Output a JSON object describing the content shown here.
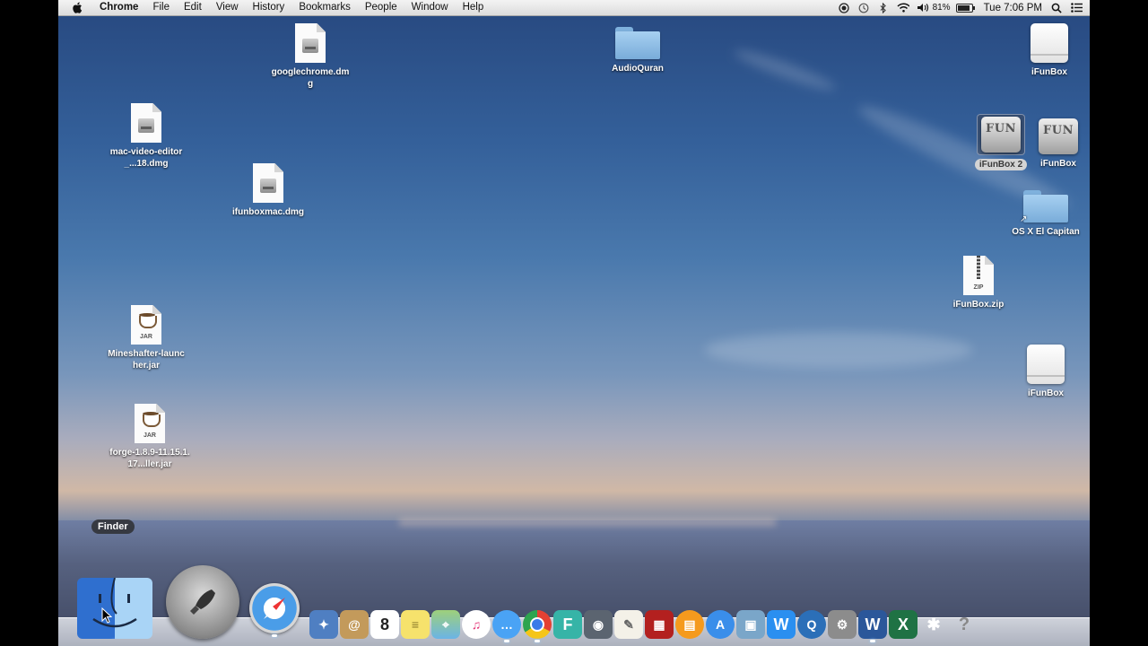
{
  "menubar": {
    "app_name": "Chrome",
    "items": [
      "File",
      "Edit",
      "View",
      "History",
      "Bookmarks",
      "People",
      "Window",
      "Help"
    ],
    "battery": "81%",
    "clock": "Tue 7:06 PM"
  },
  "desktop": {
    "icons": {
      "googlechrome": "googlechrome.dmg",
      "audioquran": "AudioQuran",
      "ifunbox_drive_top": "iFunBox",
      "mac_video_editor": "mac-video-editor_...18.dmg",
      "ifunbox2": "iFunBox 2",
      "ifunbox_app": "iFunBox",
      "ifunboxmac": "ifunboxmac.dmg",
      "osx_el_capitan": "OS X El Capitan",
      "ifunbox_zip": "iFunBox.zip",
      "mineshafter": "Mineshafter-launcher.jar",
      "ifunbox_drive_bottom": "iFunBox",
      "forge": "forge-1.8.9-11.15.1.17...ller.jar"
    },
    "fun_label": "FUN",
    "jar_tag": "JAR",
    "zip_tag": "ZIP"
  },
  "dock": {
    "tooltip": "Finder",
    "calendar_day": "8",
    "apps": [
      "Finder",
      "Launchpad",
      "Safari",
      "Preview",
      "Contacts",
      "Calendar",
      "Stickies",
      "Maps",
      "iTunes",
      "Messages",
      "Chrome",
      "F",
      "FaceTime",
      "TextEdit",
      "Photo Booth",
      "iBooks",
      "App Store",
      "iPhoto",
      "W",
      "QuickTime",
      "System Preferences",
      "Word",
      "Excel",
      "Bluetooth",
      "Help"
    ]
  },
  "colors": {
    "selection_label_bg": "#d4d4d4",
    "menubar_bg": "#e8e8e8"
  }
}
